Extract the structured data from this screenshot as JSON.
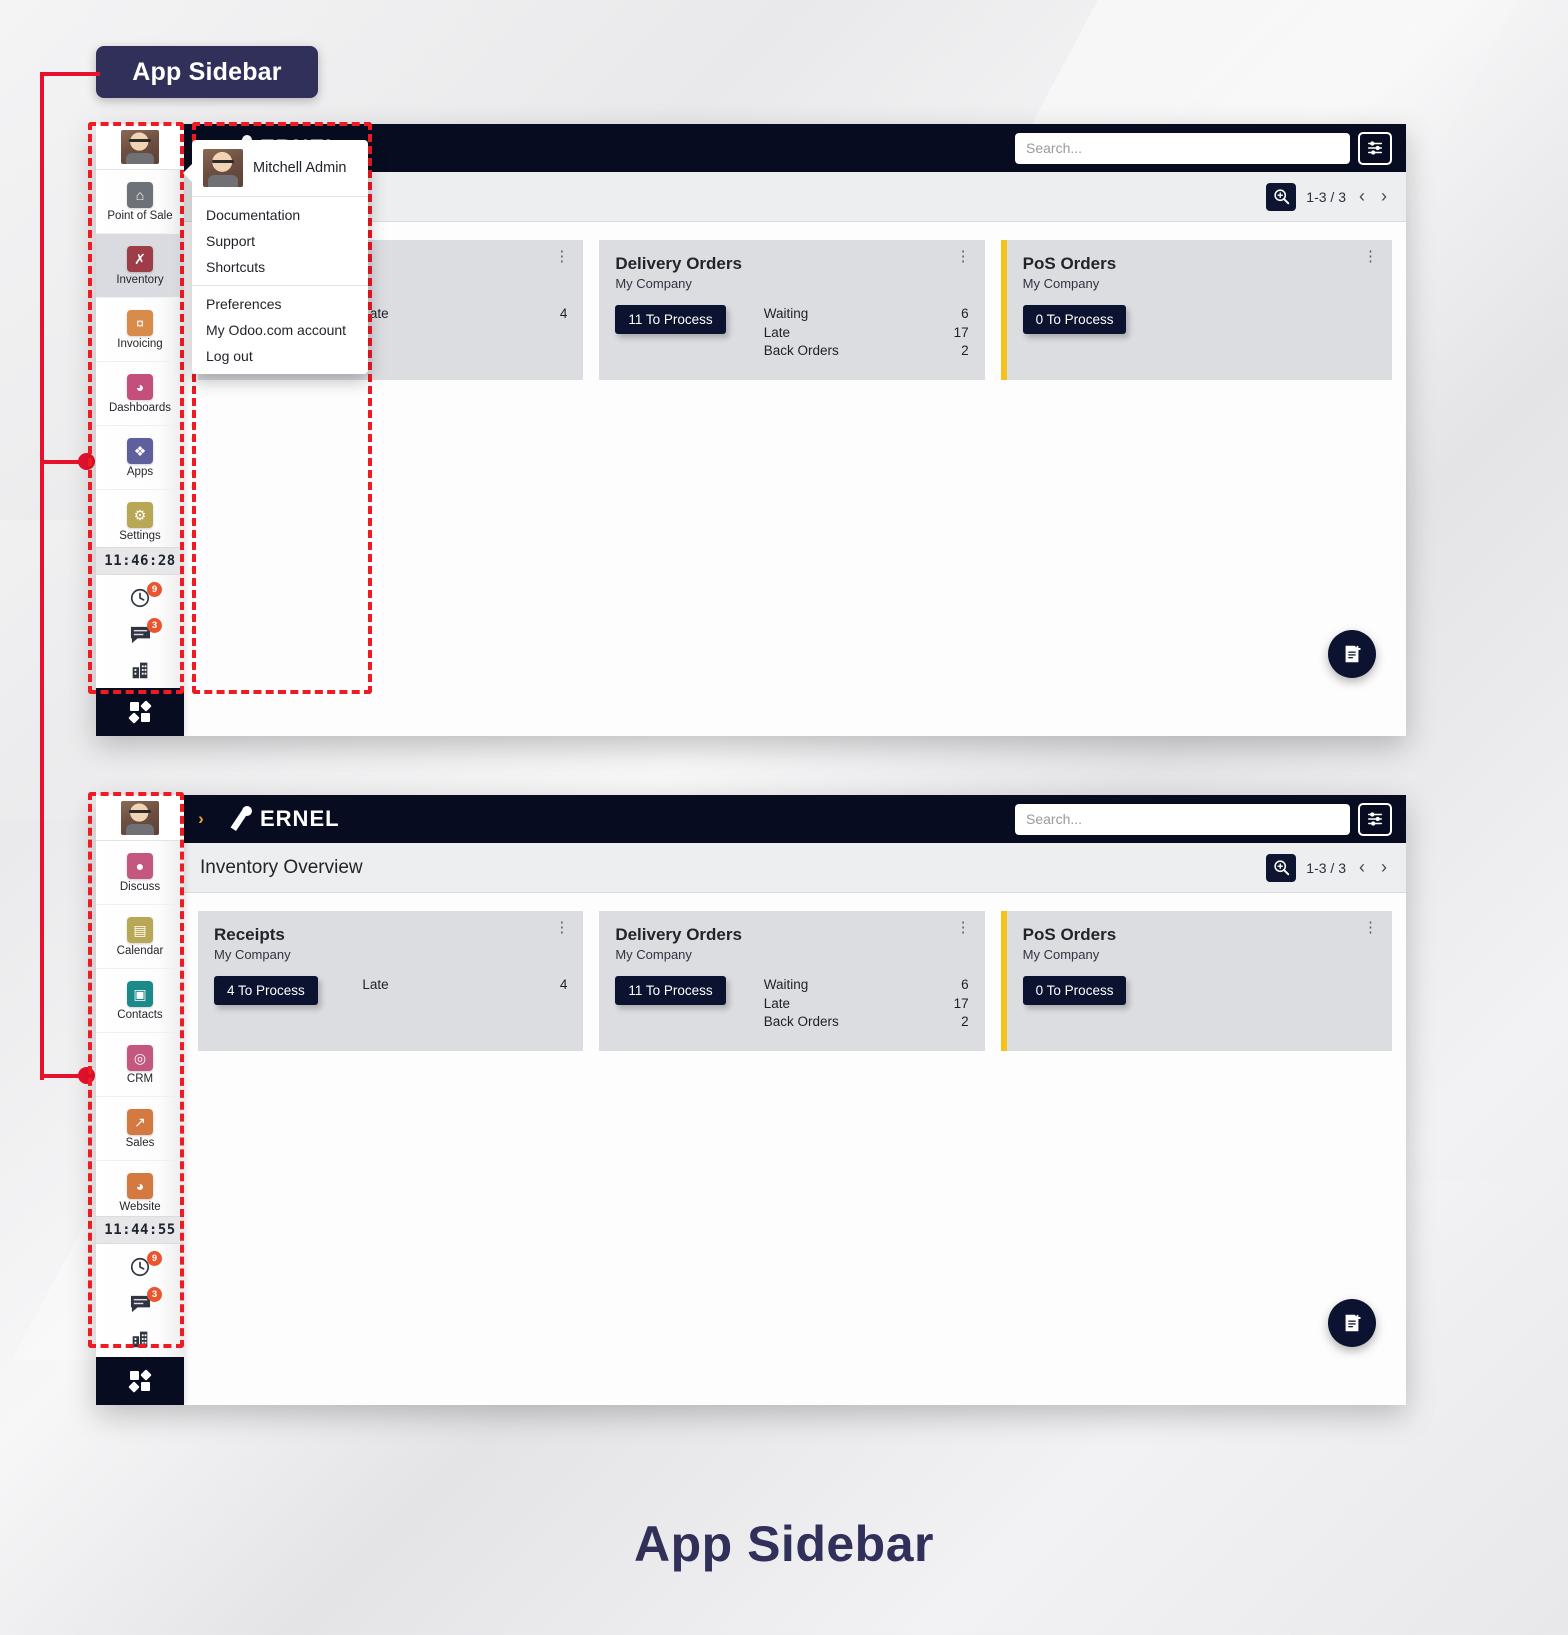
{
  "annotation": {
    "chip_label": "App Sidebar",
    "bottom_caption": "App Sidebar",
    "accent_color": "#ee1b24",
    "chip_color": "#30305a"
  },
  "navbar": {
    "toggle_icon": "chevron-right-icon",
    "brand": "ERNEL",
    "search_placeholder": "Search...",
    "search_value": "",
    "settings_icon": "sliders-icon"
  },
  "content": {
    "title": "Inventory Overview",
    "zoom_icon": "zoom-in-icon",
    "pager": "1-3 / 3",
    "prev_icon": "chevron-left-icon",
    "next_icon": "chevron-right-icon",
    "fab_icon": "new-document-icon"
  },
  "cards": [
    {
      "title": "Receipts",
      "company": "My Company",
      "button": "4 To Process",
      "accent": false,
      "stats": [
        {
          "label": "Late",
          "value": "4"
        }
      ]
    },
    {
      "title": "Delivery Orders",
      "company": "My Company",
      "button": "11 To Process",
      "accent": false,
      "stats": [
        {
          "label": "Waiting",
          "value": "6"
        },
        {
          "label": "Late",
          "value": "17"
        },
        {
          "label": "Back Orders",
          "value": "2"
        }
      ]
    },
    {
      "title": "PoS Orders",
      "company": "My Company",
      "button": "0 To Process",
      "accent": true,
      "accent_color": "#f3c31b",
      "stats": []
    }
  ],
  "sidebar_top": {
    "avatar_name": "user-avatar",
    "clock": "11:46:28",
    "apps": [
      {
        "label": "Point of Sale",
        "icon": "store-icon",
        "color": "#6d7278",
        "glyph": "⌂",
        "active": false
      },
      {
        "label": "Inventory",
        "icon": "box-icon",
        "color": "#9e3d48",
        "glyph": "✇",
        "active": true
      },
      {
        "label": "Invoicing",
        "icon": "invoice-icon",
        "color": "#d98c4a",
        "glyph": "¤",
        "active": false
      },
      {
        "label": "Dashboards",
        "icon": "gauge-icon",
        "color": "#c44f7c",
        "glyph": "◔",
        "active": false
      },
      {
        "label": "Apps",
        "icon": "puzzle-icon",
        "color": "#5f5f9e",
        "glyph": "❖",
        "active": false
      },
      {
        "label": "Settings",
        "icon": "gear-icon",
        "color": "#b8a855",
        "glyph": "⚙",
        "active": false
      }
    ],
    "tools": [
      {
        "icon": "clock-icon",
        "badge": "9"
      },
      {
        "icon": "messages-icon",
        "badge": "3"
      },
      {
        "icon": "building-icon",
        "badge": ""
      }
    ],
    "bottom_icon": "apps-grid-icon"
  },
  "sidebar_bottom": {
    "avatar_name": "user-avatar",
    "clock": "11:44:55",
    "apps": [
      {
        "label": "Discuss",
        "icon": "chat-icon",
        "color": "#c4577f",
        "glyph": "●",
        "active": false
      },
      {
        "label": "Calendar",
        "icon": "calendar-icon",
        "color": "#b8a855",
        "glyph": "▤",
        "active": false
      },
      {
        "label": "Contacts",
        "icon": "contacts-icon",
        "color": "#1b8a8a",
        "glyph": "▣",
        "active": false
      },
      {
        "label": "CRM",
        "icon": "lifebuoy-icon",
        "color": "#c4577f",
        "glyph": "◎",
        "active": false
      },
      {
        "label": "Sales",
        "icon": "chart-up-icon",
        "color": "#d4793f",
        "glyph": "↗",
        "active": false
      },
      {
        "label": "Website",
        "icon": "globe-icon",
        "color": "#d4793f",
        "glyph": "◕",
        "active": false
      }
    ],
    "tools": [
      {
        "icon": "clock-icon",
        "badge": "9"
      },
      {
        "icon": "messages-icon",
        "badge": "3"
      },
      {
        "icon": "building-icon",
        "badge": ""
      }
    ],
    "bottom_icon": "apps-grid-icon"
  },
  "user_menu": {
    "name": "Mitchell Admin",
    "groups": [
      [
        "Documentation",
        "Support",
        "Shortcuts"
      ],
      [
        "Preferences",
        "My Odoo.com account",
        "Log out"
      ]
    ]
  }
}
